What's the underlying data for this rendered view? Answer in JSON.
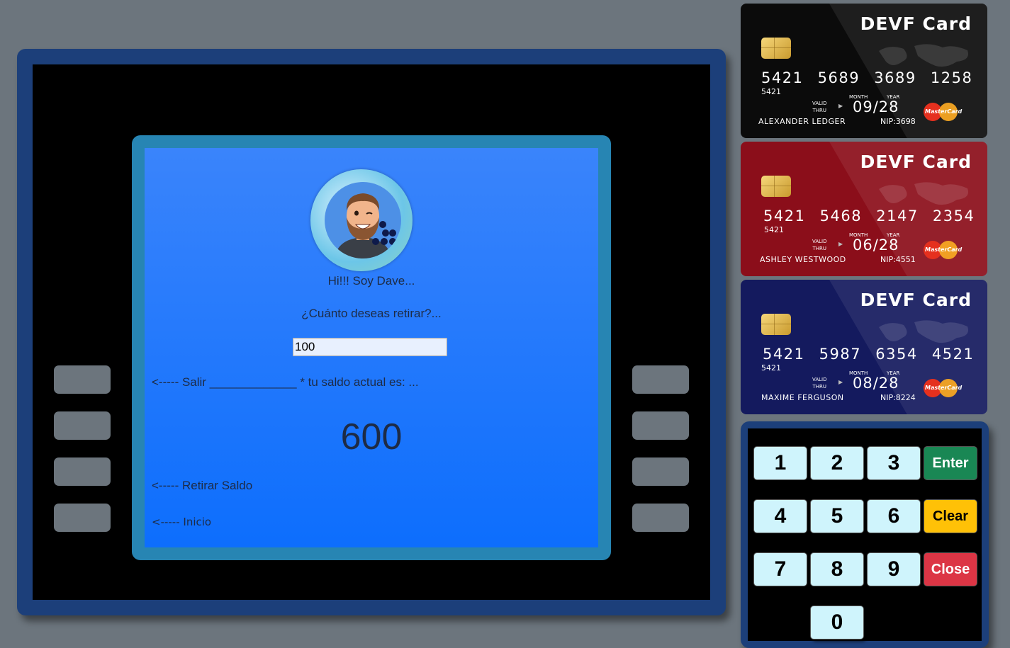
{
  "screen": {
    "greeting": "Hi!!! Soy Dave...",
    "question": "¿Cuánto deseas retirar?...",
    "amount_value": "100",
    "exit_line": "<----- Salir _____________ * tu saldo actual es: ...",
    "balance": "600",
    "withdraw_line": "<----- Retirar Saldo",
    "home_line": "<----- Inicio"
  },
  "cards": [
    {
      "brand": "DEVF Card",
      "number": "5421 5689 3689 1258",
      "bin": "5421",
      "valid_thru": "VALID\nTHRU",
      "month_label": "MONTH",
      "year_label": "YEAR",
      "expiry": "09/28",
      "holder": "ALEXANDER LEDGER",
      "nip": "NIP:3698",
      "network": "MasterCard",
      "color": "#0b0b0b"
    },
    {
      "brand": "DEVF Card",
      "number": "5421 5468 2147 2354",
      "bin": "5421",
      "valid_thru": "VALID\nTHRU",
      "month_label": "MONTH",
      "year_label": "YEAR",
      "expiry": "06/28",
      "holder": "ASHLEY WESTWOOD",
      "nip": "NIP:4551",
      "network": "MasterCard",
      "color": "#8b0e1a"
    },
    {
      "brand": "DEVF Card",
      "number": "5421 5987 6354 4521",
      "bin": "5421",
      "valid_thru": "VALID\nTHRU",
      "month_label": "MONTH",
      "year_label": "YEAR",
      "expiry": "08/28",
      "holder": "MAXIME FERGUSON",
      "nip": "NIP:8224",
      "network": "MasterCard",
      "color": "#141a5e"
    }
  ],
  "keypad": {
    "keys": [
      "1",
      "2",
      "3",
      "4",
      "5",
      "6",
      "7",
      "8",
      "9",
      "0"
    ],
    "enter": "Enter",
    "clear": "Clear",
    "close": "Close"
  },
  "colors": {
    "background": "#6c757d",
    "atm_frame": "#1c3f7a",
    "screen_frame": "#2785b3",
    "enter": "#198754",
    "clear": "#ffc107",
    "close": "#dc3545",
    "key": "#cff4fc"
  },
  "icons": {
    "avatar": "avatar-dave",
    "chip": "chip-icon",
    "network": "mastercard-logo"
  }
}
